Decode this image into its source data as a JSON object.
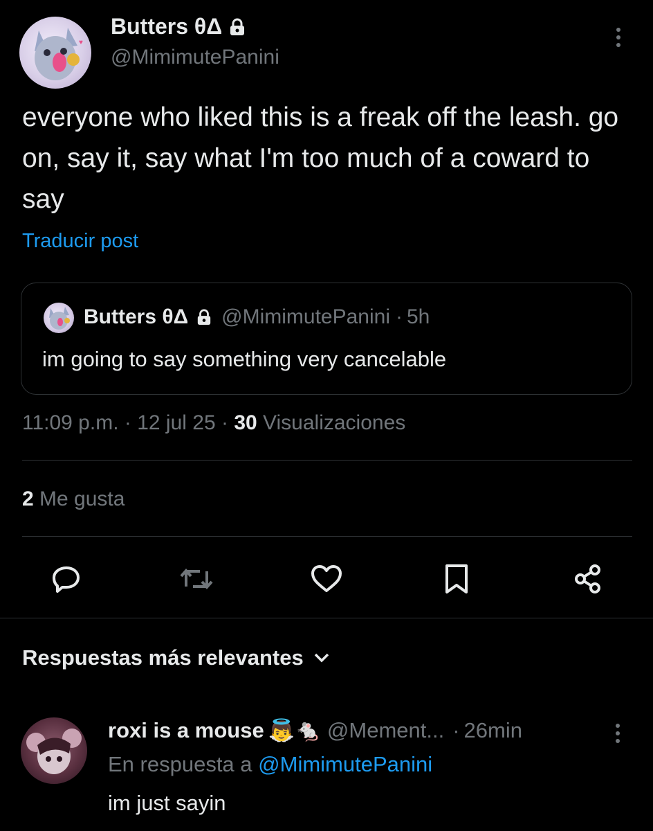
{
  "post": {
    "author_name": "Butters θΔ",
    "author_handle": "@MimimutePanini",
    "text": "everyone who liked this is a freak off the leash. go on, say it, say what I'm too much of a coward to say",
    "translate_label": "Traducir post",
    "time": "11:09 p.m.",
    "date": "12 jul 25",
    "views_count": "30",
    "views_label": "Visualizaciones",
    "likes_count": "2",
    "likes_label": "Me gusta"
  },
  "quote": {
    "author_name": "Butters θΔ",
    "author_handle": "@MimimutePanini",
    "age": "5h",
    "text": "im going to say something very cancelable"
  },
  "actions": [
    "reply-icon",
    "repost-icon",
    "like-icon",
    "bookmark-icon",
    "share-icon"
  ],
  "replies_section": {
    "sort_label": "Respuestas más relevantes"
  },
  "reply": {
    "author_name": "roxi is a mouse",
    "author_emoji": "👼🐁",
    "author_handle": "@Mement...",
    "age": "26min",
    "in_reply_prefix": "En respuesta a",
    "in_reply_mention": "@MimimutePanini",
    "text": "im just sayin"
  },
  "colors": {
    "background": "#000000",
    "text": "#e7e9ea",
    "secondary": "#71767b",
    "accent": "#1d9bf0",
    "divider": "#2f3336"
  }
}
